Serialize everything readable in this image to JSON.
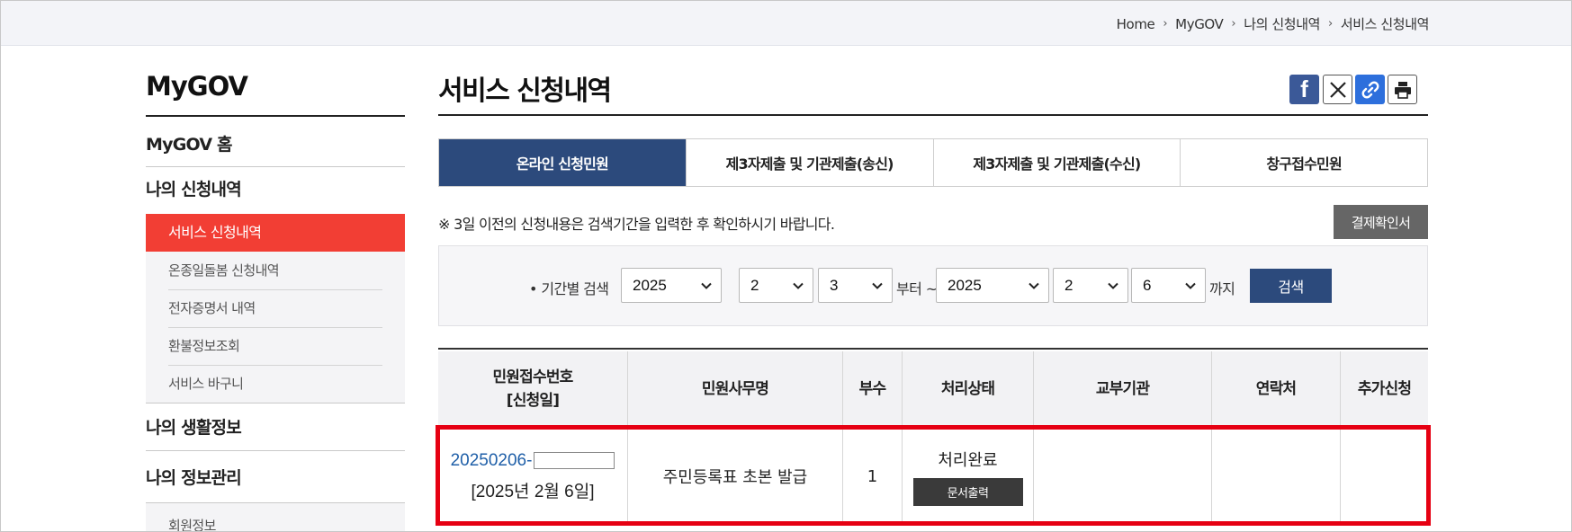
{
  "breadcrumb": [
    "Home",
    "MyGOV",
    "나의 신청내역",
    "서비스 신청내역"
  ],
  "sidebar": {
    "title": "MyGOV",
    "home": "MyGOV 홈",
    "my_applications": "나의 신청내역",
    "sub_items": [
      "서비스 신청내역",
      "온종일돌봄 신청내역",
      "전자증명서 내역",
      "환불정보조회",
      "서비스 바구니"
    ],
    "active_index": 0,
    "life_info": "나의 생활정보",
    "info_manage": "나의 정보관리",
    "member_info": "회원정보"
  },
  "page": {
    "title": "서비스 신청내역",
    "share_icons": [
      "facebook-icon",
      "x-icon",
      "link-icon",
      "print-icon"
    ]
  },
  "tabs": [
    "온라인 신청민원",
    "제3자제출 및 기관제출(송신)",
    "제3자제출 및 기관제출(수신)",
    "창구접수민원"
  ],
  "active_tab": 0,
  "notice": "※ 3일 이전의 신청내용은 검색기간을 입력한 후 확인하시기 바랍니다.",
  "payment_button": "결제확인서",
  "search": {
    "label": "기간별 검색",
    "from_year": "2025",
    "from_month": "2",
    "from_day": "3",
    "from_suffix": "부터 ~",
    "to_year": "2025",
    "to_month": "2",
    "to_day": "6",
    "to_suffix": "까지",
    "button": "검색"
  },
  "table": {
    "headers": {
      "receipt_line1": "민원접수번호",
      "receipt_line2": "[신청일]",
      "service_name": "민원사무명",
      "copies": "부수",
      "status": "처리상태",
      "issuing_agency": "교부기관",
      "contact": "연락처",
      "additional": "추가신청"
    },
    "rows": [
      {
        "receipt_no": "20250206-",
        "applied_date": "[2025년 2월 6일]",
        "service_name": "주민등록표 초본 발급",
        "copies": "1",
        "status": "처리완료",
        "print_button": "문서출력",
        "issuing_agency": "",
        "contact": "",
        "additional": ""
      }
    ]
  },
  "colors": {
    "accent_red": "#f23e34",
    "navy": "#2c4a7c",
    "highlight_red": "#e60012",
    "link_blue": "#1f5fa8"
  }
}
